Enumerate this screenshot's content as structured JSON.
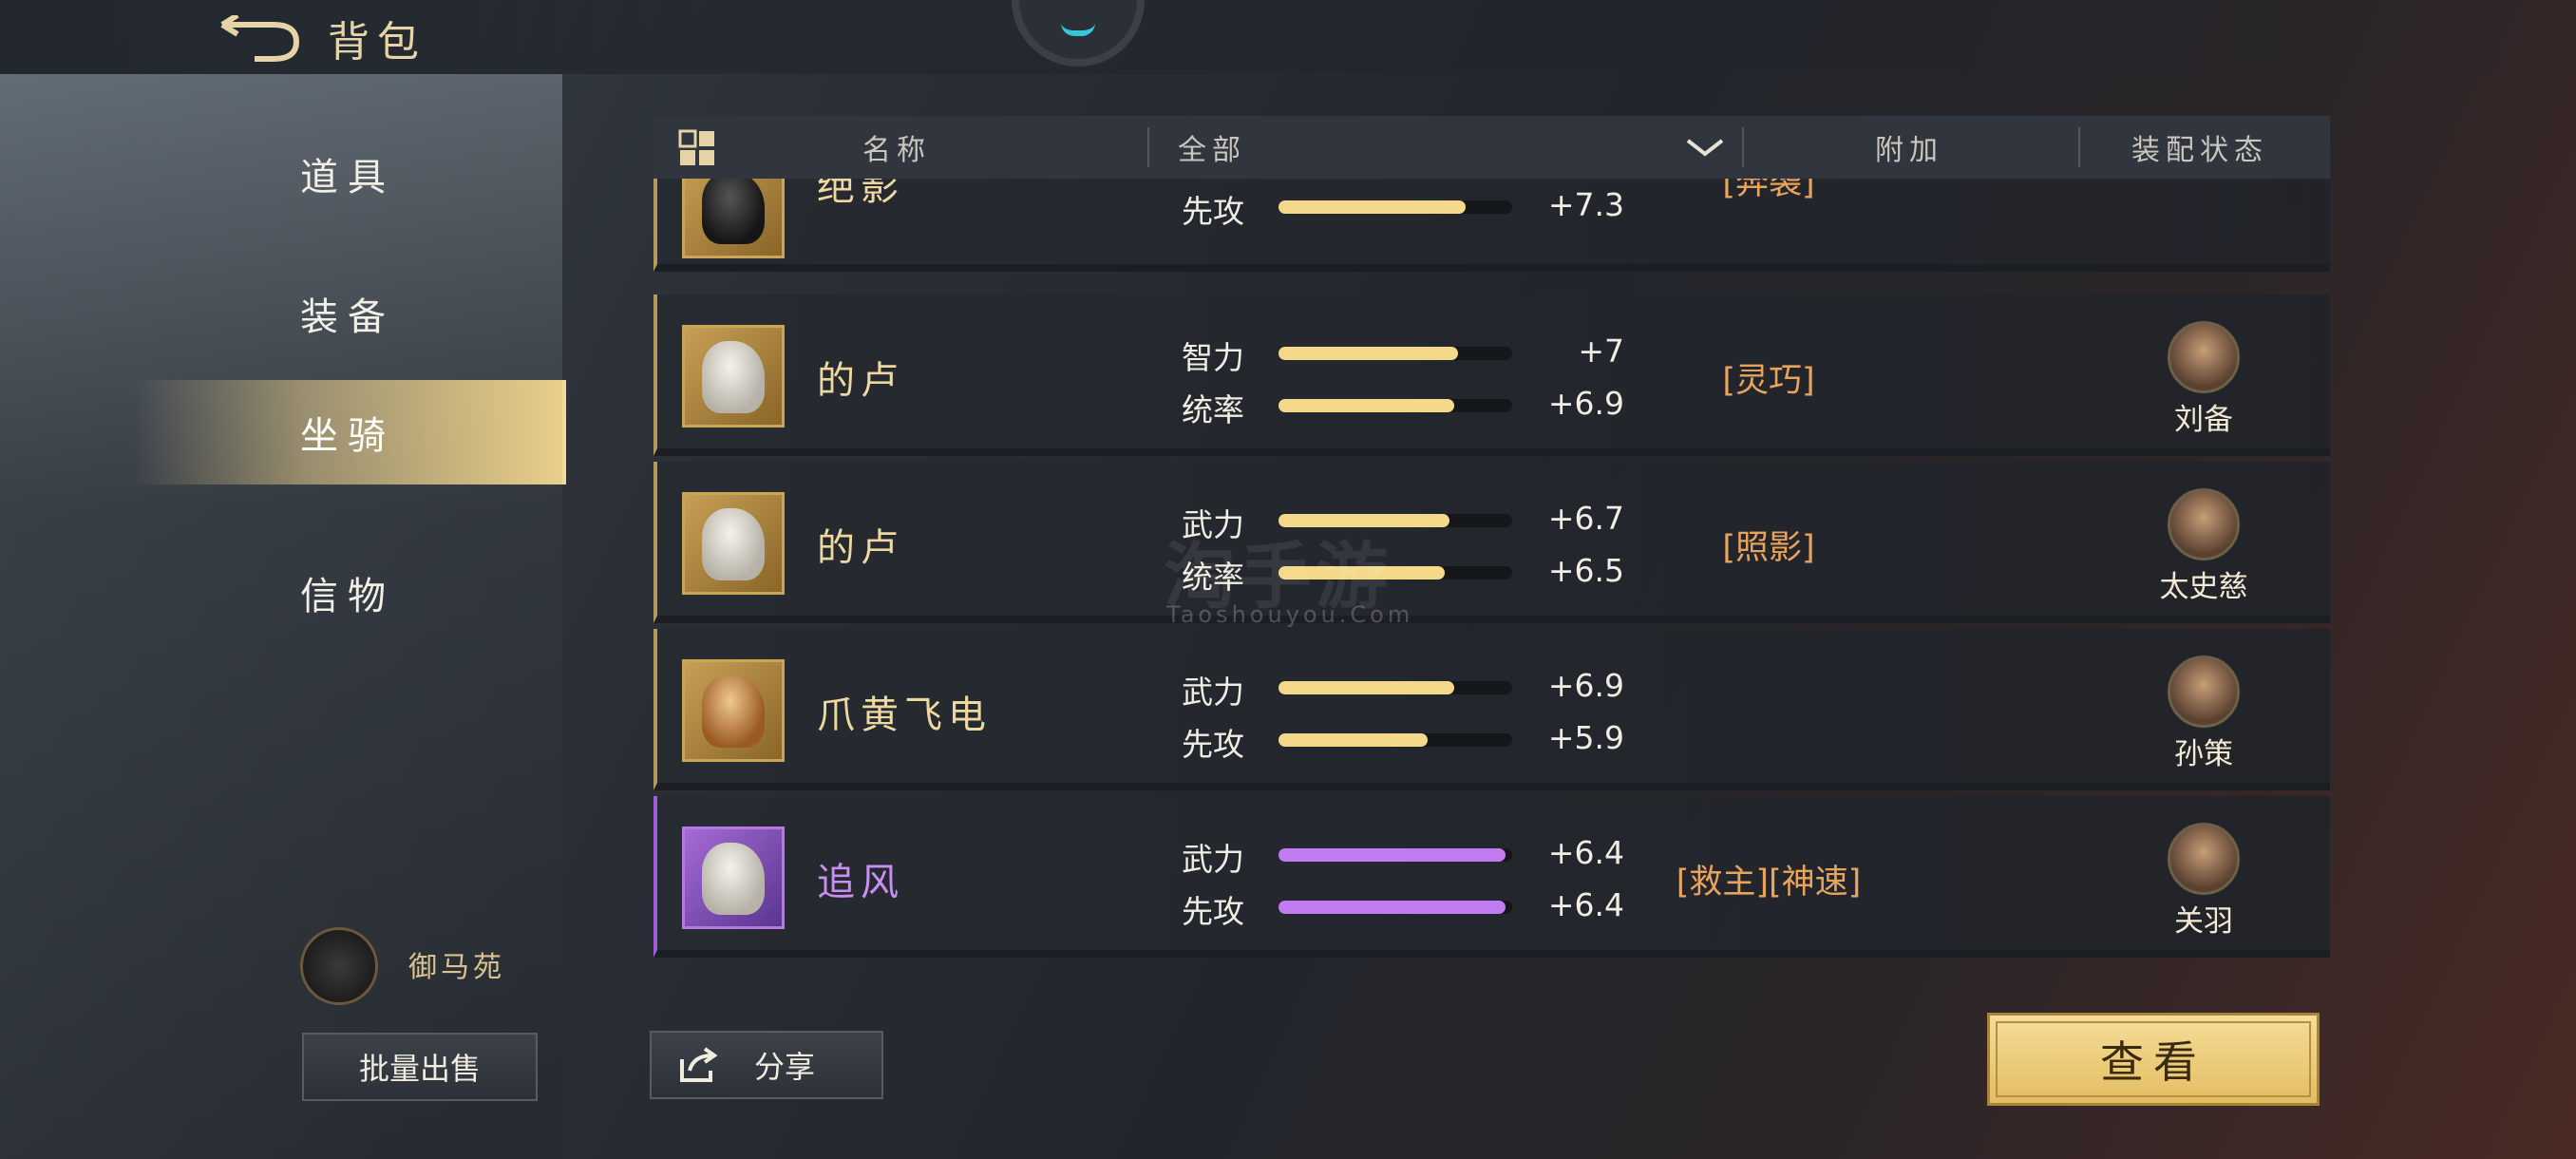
{
  "header": {
    "title": "背包"
  },
  "sidebar": {
    "items": [
      {
        "label": "道具"
      },
      {
        "label": "装备"
      },
      {
        "label": "坐骑"
      },
      {
        "label": "信物"
      }
    ],
    "active_index": 2,
    "stable_label": "御马苑",
    "bulk_sell_label": "批量出售"
  },
  "table": {
    "col_name": "名称",
    "filter_value": "全部",
    "col_extra": "附加",
    "col_status": "装配状态",
    "rows": [
      {
        "name": "绝影",
        "stats": [
          {
            "label": "先攻",
            "value": "+7.3",
            "fill": 0.8
          }
        ],
        "extra": "[奔袭]",
        "general": ""
      },
      {
        "name": "的卢",
        "stats": [
          {
            "label": "智力",
            "value": "+7",
            "fill": 0.77
          },
          {
            "label": "统率",
            "value": "+6.9",
            "fill": 0.75
          }
        ],
        "extra": "[灵巧]",
        "general": "刘备"
      },
      {
        "name": "的卢",
        "stats": [
          {
            "label": "武力",
            "value": "+6.7",
            "fill": 0.73
          },
          {
            "label": "统率",
            "value": "+6.5",
            "fill": 0.71
          }
        ],
        "extra": "[照影]",
        "general": "太史慈"
      },
      {
        "name": "爪黄飞电",
        "stats": [
          {
            "label": "武力",
            "value": "+6.9",
            "fill": 0.75
          },
          {
            "label": "先攻",
            "value": "+5.9",
            "fill": 0.64
          }
        ],
        "extra": "",
        "general": "孙策"
      },
      {
        "name": "追风",
        "stats": [
          {
            "label": "武力",
            "value": "+6.4",
            "fill": 0.97
          },
          {
            "label": "先攻",
            "value": "+6.4",
            "fill": 0.97
          }
        ],
        "extra": "[救主][神速]",
        "general": "关羽"
      }
    ]
  },
  "footer": {
    "share_label": "分享",
    "view_label": "查看"
  },
  "watermark": {
    "main": "淘手游",
    "sub": "Taoshouyou.Com"
  },
  "colors": {
    "gold": "#e9cf8a",
    "purple": "#c07cf0",
    "extra_orange": "#e9a45c"
  }
}
